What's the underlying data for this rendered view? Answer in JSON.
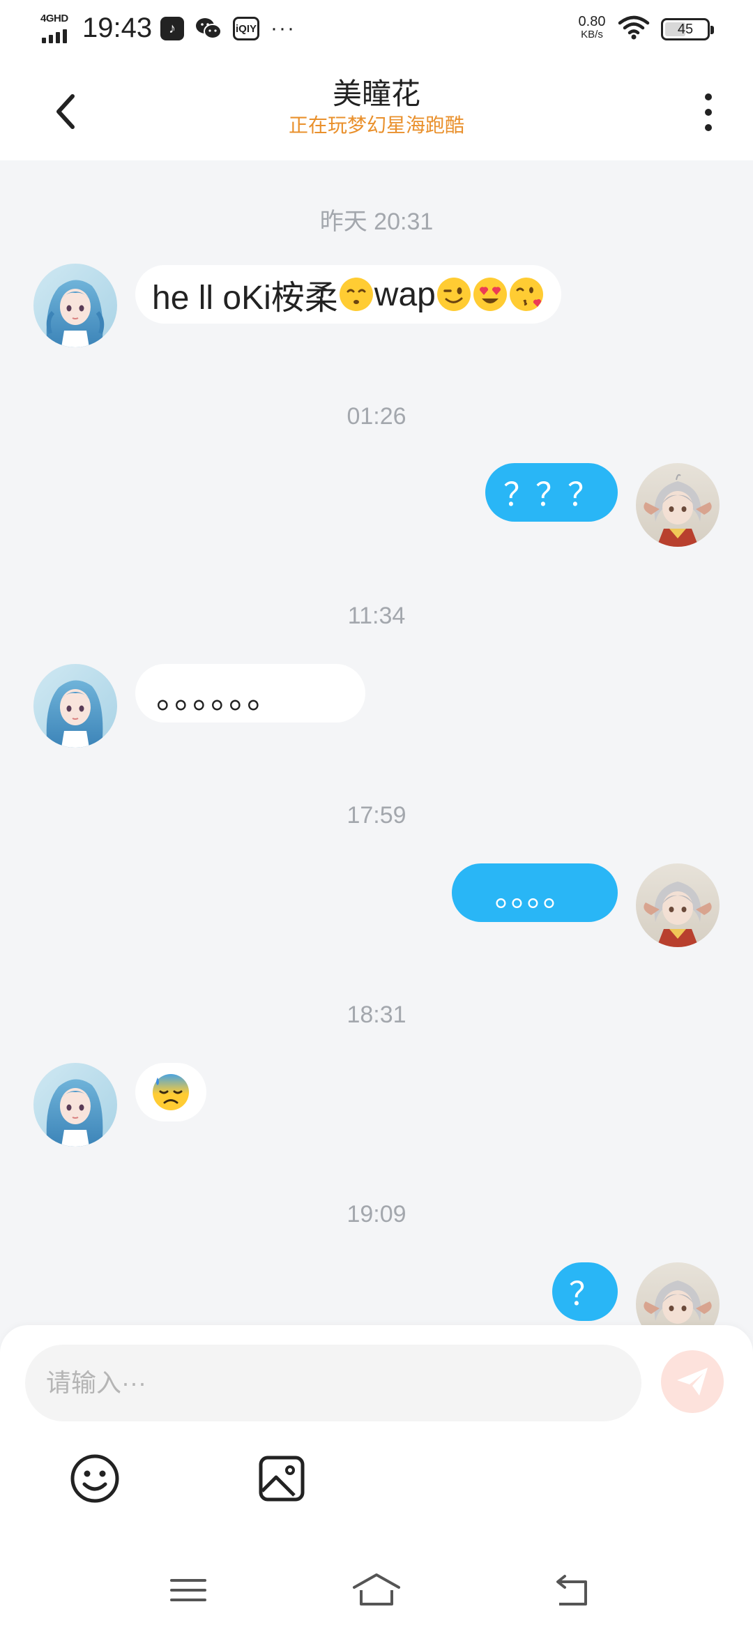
{
  "status_bar": {
    "network": "4GHD",
    "time": "19:43",
    "app_icons": [
      "tiktok-icon",
      "wechat-icon",
      "iqiyi-icon"
    ],
    "iqiyi_label": "iQIY",
    "more_dots": "···",
    "speed_value": "0.80",
    "speed_unit": "KB/s",
    "battery": "45"
  },
  "header": {
    "title": "美瞳花",
    "subtitle": "正在玩梦幻星海跑酷",
    "back_icon": "chevron-left-icon",
    "more_icon": "vertical-dots-icon",
    "subtitle_color": "#e9902c"
  },
  "messages": [
    {
      "timestamp": "昨天 20:31",
      "side": "in",
      "text": "he ll oKi桉柔",
      "text2": "wap",
      "emojis_after_1": [
        "kissing-smiling-eyes"
      ],
      "emojis_after_2": [
        "winking-face",
        "heart-eyes",
        "face-blowing-kiss"
      ]
    },
    {
      "timestamp": "01:26",
      "side": "out",
      "text": "？？？"
    },
    {
      "timestamp": "11:34",
      "side": "in",
      "text": "。。。。。。"
    },
    {
      "timestamp": "17:59",
      "side": "out",
      "text": "。。。。"
    },
    {
      "timestamp": "18:31",
      "side": "in",
      "emojis": [
        "anxious-face-with-sweat"
      ]
    },
    {
      "timestamp": "19:09",
      "side": "out",
      "text": "？"
    }
  ],
  "composer": {
    "placeholder": "请输入···",
    "send_icon": "paper-plane-icon",
    "emoji_button_icon": "smiley-icon",
    "image_button_icon": "image-icon"
  },
  "nav_bar": {
    "icons": [
      "menu-icon",
      "home-icon",
      "back-icon"
    ]
  },
  "colors": {
    "outgoing_bubble": "#29b6f6",
    "incoming_bubble": "#ffffff",
    "background": "#f4f5f7",
    "send_button": "#fde2dc",
    "timestamp": "#a3a7ad"
  }
}
